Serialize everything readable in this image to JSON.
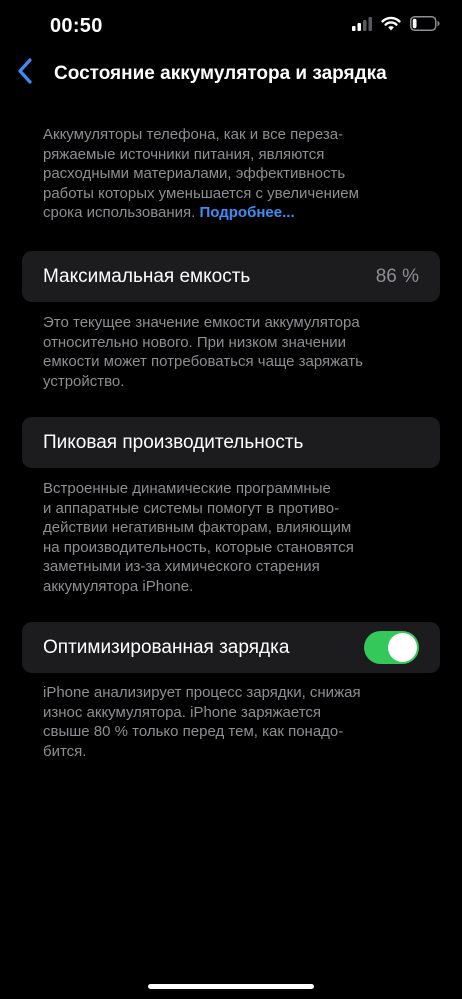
{
  "status_bar": {
    "time": "00:50",
    "signal_icon": "cellular-signal-icon",
    "wifi_icon": "wifi-icon",
    "battery_icon": "battery-icon",
    "battery_level": 0.18
  },
  "nav": {
    "back_icon": "chevron-left-icon",
    "title": "Состояние аккумулятора и зарядка"
  },
  "intro": {
    "lines": [
      "Аккумуляторы телефона, как и все переза-",
      "ряжаемые источники питания, являются",
      "расходными материалами, эффективность",
      "работы которых уменьшается с увеличением",
      "срока использования."
    ],
    "link_label": "Подробнее..."
  },
  "max_capacity": {
    "label": "Максимальная емкость",
    "value": "86 %",
    "description_lines": [
      "Это текущее значение емкости аккумулятора",
      "относительно нового. При низком значении",
      "емкости может потребоваться чаще заряжать",
      "устройство."
    ]
  },
  "peak_performance": {
    "label": "Пиковая производительность",
    "description_lines": [
      "Встроенные динамические программные",
      "и аппаратные системы помогут в противо-",
      "действии негативным факторам, влияющим",
      "на производительность, которые становятся",
      "заметными из-за химического старения",
      "аккумулятора iPhone."
    ]
  },
  "optimized_charging": {
    "label": "Оптимизированная зарядка",
    "enabled": true,
    "description_lines": [
      "iPhone анализирует процесс зарядки, снижая",
      "износ аккумулятора. iPhone заряжается",
      "свыше 80 % только перед тем, как понадо-",
      "бится."
    ]
  },
  "colors": {
    "background": "#000000",
    "cell": "#1c1c1e",
    "secondary_text": "#8e8e93",
    "accent": "#3a8ef6",
    "toggle_on": "#34c759"
  }
}
